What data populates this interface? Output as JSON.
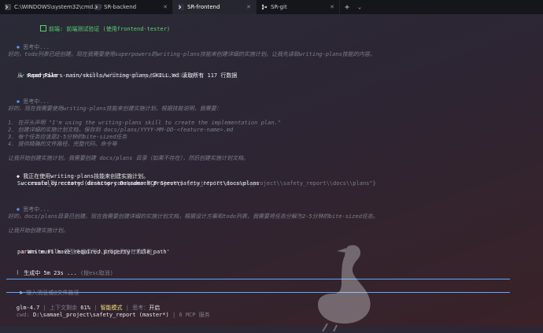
{
  "tabs": [
    {
      "title": "C:\\WINDOWS\\system32\\cmd.",
      "icon": "cmd-icon",
      "active": false
    },
    {
      "title": "SR-backend",
      "icon": "terminal-icon",
      "active": false
    },
    {
      "title": "SR-frontend",
      "icon": "terminal-icon",
      "active": true
    },
    {
      "title": "SR-git",
      "icon": "git-icon",
      "active": false
    }
  ],
  "terminal": {
    "todo_item": "前端: 前端测试验证 (使用frontend-tester)",
    "think1_header": "思考中...",
    "think1_body": "好的，todo列表已经创建。现在我需要使用superpowers的writing-plans技能来创建详细的实施计划。让我先读取writing-plans技能的内容。",
    "read_label": "Read File",
    "read_path": "...ers-main\\skills\\writing-plans\\SKILL.md",
    "read_result": "从 superpowers-main/skills/writing-plans/SKILL.md 读取所有 117 行数据",
    "think2_header": "思考中...",
    "think2_body": "好的，现在我需要使用writing-plans技能来创建实施计划。根据技能说明，我需要：",
    "steps": [
      "1. 在开头声明 \"I'm using the writing-plans skill to create the implementation plan.\"",
      "2. 创建详细的实施计划文档，保存到 docs/plans/YYYY-MM-DD-<feature-name>.md",
      "3. 每个任务应该是2-5分钟的bite-sized任务",
      "4. 提供精确的文件路径、完整代码、命令等"
    ],
    "think2_tail": "让我开始创建实施计划。我需要创建 docs/plans 目录（如果不存在），然后创建实施计划文档。",
    "using_skill": "我正在使用writing-plans技能来创建实施计划。",
    "tool_name": "create_directory (desktop-commander MCP Server)",
    "tool_args": "{\"path\":\"D:\\\\samael_project\\\\safety_report\\\\docs\\\\plans\"}",
    "tool_result": "Successfully created directory D:\\samael_project\\safety_report\\docs\\plans",
    "think3_header": "思考中...",
    "think3_body": "好的，docs/plans目录已创建。现在我需要创建详细的实施计划文档，根据设计方案和todo列表，我需要将任务分解为2-5分钟的bite-sized任务。",
    "think3_tail": "让我开始创建实施计划。",
    "write_label": "Write File",
    "write_error_hint": "模型未提供写入文件工具的有效参数",
    "write_error": "params must have required property 'file_path'",
    "generating": "生成中",
    "elapsed": "5m 23s ...",
    "cancel_hint": "(按esc取消)",
    "prompt_symbol": ">",
    "input_placeholder": "输入消息或@文件路径",
    "model": "glm-4.7",
    "context_label": "上下文剩余",
    "context_value": "61%",
    "mode": "智能模式",
    "thinking_label": "思考：",
    "thinking_value": "开启",
    "cwd_label": "cwd:",
    "cwd_value": "D:\\samael_project\\safety_report (master*)",
    "mcp_status": "6 MCP 服务"
  },
  "colors": {
    "accent": "#5aa0ff",
    "success": "#59d36b",
    "error": "#e5534b",
    "muted": "#7c7e8a"
  }
}
